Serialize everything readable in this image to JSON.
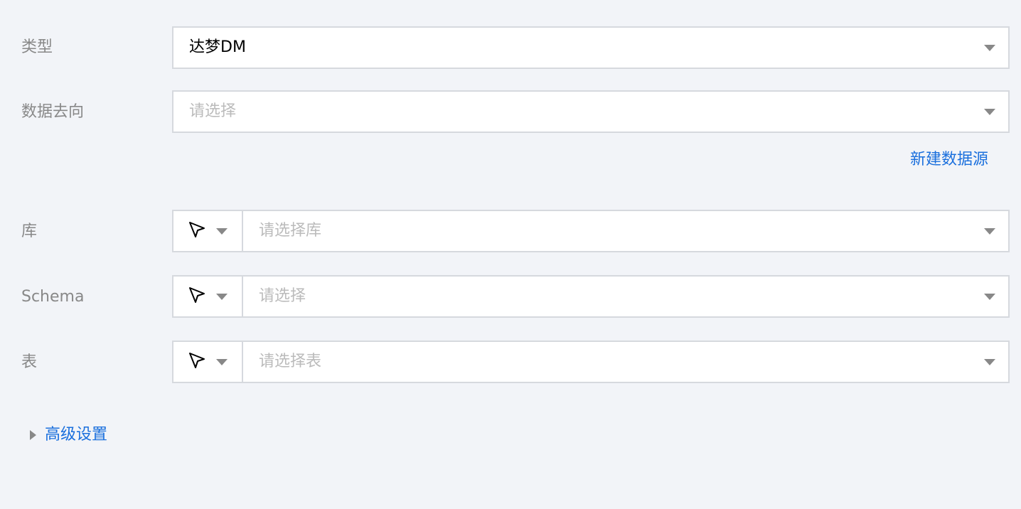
{
  "form": {
    "type": {
      "label": "类型",
      "value": "达梦DM"
    },
    "destination": {
      "label": "数据去向",
      "placeholder": "请选择"
    },
    "new_datasource_link": "新建数据源",
    "database": {
      "label": "库",
      "placeholder": "请选择库",
      "mode_icon": "cursor-arrow-icon"
    },
    "schema": {
      "label": "Schema",
      "placeholder": "请选择",
      "mode_icon": "cursor-arrow-icon"
    },
    "table": {
      "label": "表",
      "placeholder": "请选择表",
      "mode_icon": "cursor-arrow-icon"
    },
    "advanced_settings": "高级设置"
  },
  "colors": {
    "background": "#f2f4f8",
    "label": "#888888",
    "placeholder": "#bbbbbb",
    "link": "#1a6fdd",
    "border": "#d6d9de"
  }
}
